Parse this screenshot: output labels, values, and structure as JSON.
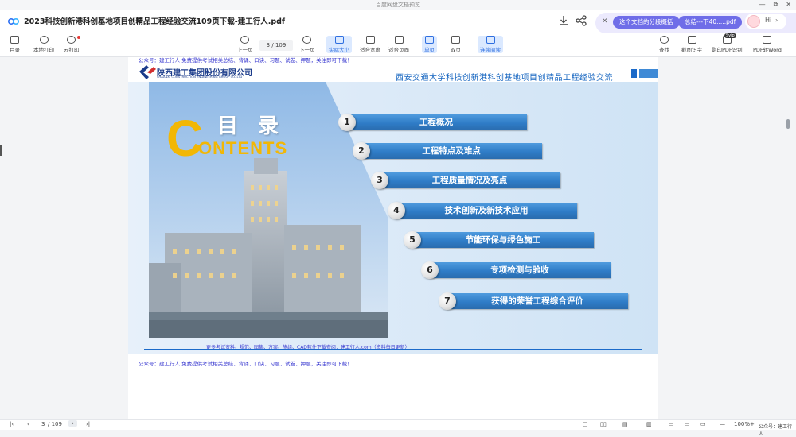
{
  "window": {
    "title": "百度网盘文档预览",
    "controls": [
      "—",
      "⧉",
      "✕"
    ]
  },
  "tabbar": {
    "doc_title": "2023科技创新港科创基地项目创精品工程经验交流109页下载-建工行人.pdf",
    "ai": {
      "summary_btn": "这个文档的分段概括",
      "file_btn": "总结---下40.....pdf",
      "hi": "Hi"
    }
  },
  "toolbar": {
    "left": [
      {
        "label": "目录"
      },
      {
        "label": "本地打印"
      },
      {
        "label": "云打印"
      }
    ],
    "prev": "上一页",
    "page_current": "3",
    "page_total": "/ 109",
    "next": "下一页",
    "view": [
      {
        "label": "实际大小"
      },
      {
        "label": "适合宽度"
      },
      {
        "label": "适合页面"
      },
      {
        "label": "单页"
      },
      {
        "label": "双页"
      },
      {
        "label": "连续阅读"
      }
    ],
    "right": [
      {
        "label": "查找"
      },
      {
        "label": "截图识字"
      },
      {
        "label": "影印PDF识别"
      },
      {
        "label": "PDF转Word"
      }
    ],
    "new_badge": "Svip"
  },
  "page": {
    "watermark_top": "公众号：建工行人 免费提供考试相关总结、背诵、口诀、习题、试卷、押题，关注即可下载！",
    "watermark_bottom": "公众号：建工行人 免费提供考试相关总结、背诵、口诀、习题、试卷、押题，关注即可下载！",
    "footer_text": "更多考试资料、规范、图集、方案、施组、CAD软件下载查阅：建工行人.com（资料每日更新）",
    "logo_cn": "陕西建工集团股份有限公司",
    "logo_en": "SHAANXI CONSTRUCTION ENGINEERING GROUP CO.,LTD",
    "slide_title": "西安交通大学科技创新港科创基地项目创精品工程经验交流",
    "mulu": "目 录",
    "contents": "ONTENTS",
    "contents_c": "C",
    "toc": [
      {
        "num": "1",
        "label": "工程概况"
      },
      {
        "num": "2",
        "label": "工程特点及难点"
      },
      {
        "num": "3",
        "label": "工程质量情况及亮点"
      },
      {
        "num": "4",
        "label": "技术创新及新技术应用"
      },
      {
        "num": "5",
        "label": "节能环保与绿色施工"
      },
      {
        "num": "6",
        "label": "专项检测与验收"
      },
      {
        "num": "7",
        "label": "获得的荣誉工程综合评价"
      }
    ]
  },
  "statusbar": {
    "page_current": "3",
    "page_total": "/ 109",
    "zoom": "100%",
    "corner": "公众号：建工行人"
  },
  "colors": {
    "accent": "#2f6fe0",
    "ai_purple": "#6f6de8",
    "toc_blue": "#2f7cc7",
    "contents_yellow": "#f2b705"
  }
}
